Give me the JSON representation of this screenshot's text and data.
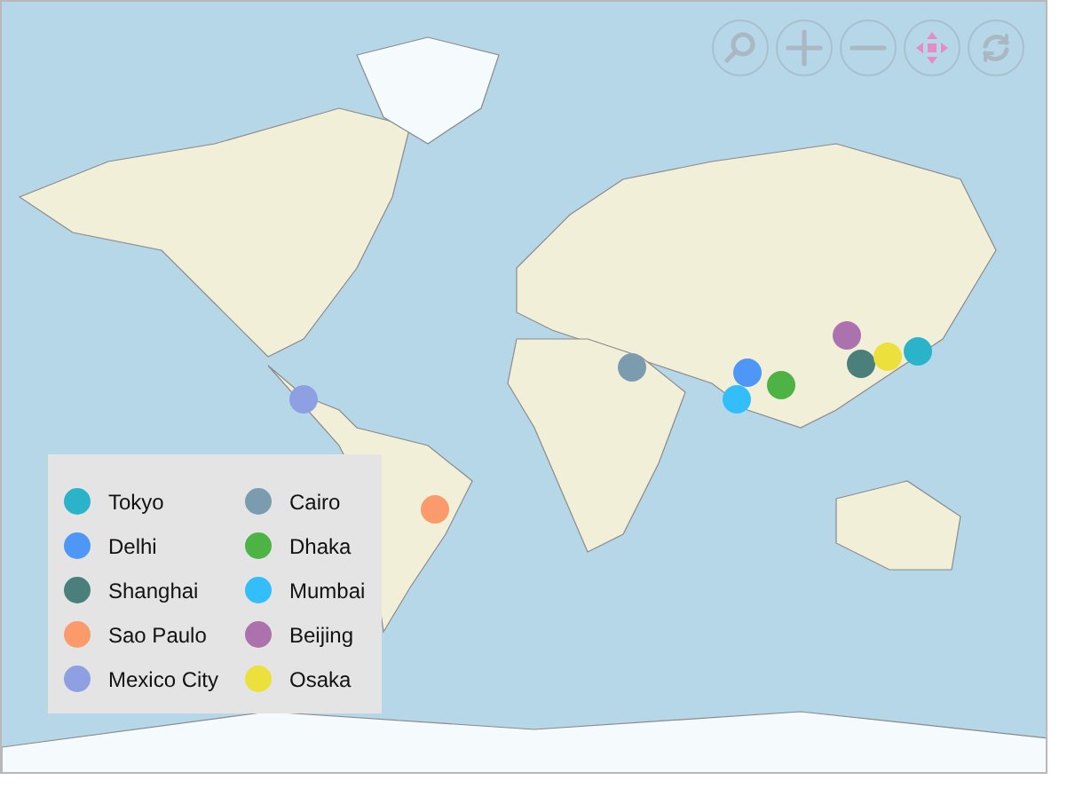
{
  "toolbar": [
    {
      "kind": "zoom"
    },
    {
      "kind": "zoom-in"
    },
    {
      "kind": "zoom-out"
    },
    {
      "kind": "pan",
      "selected": true
    },
    {
      "kind": "reset"
    }
  ],
  "cities": [
    {
      "name": "Tokyo",
      "color": "#2bb3c9"
    },
    {
      "name": "Delhi",
      "color": "#4e97f7"
    },
    {
      "name": "Shanghai",
      "color": "#4a7f7c"
    },
    {
      "name": "Sao Paulo",
      "color": "#fb9a6a"
    },
    {
      "name": "Mexico City",
      "color": "#8fa0e2"
    },
    {
      "name": "Cairo",
      "color": "#7b9caf"
    },
    {
      "name": "Dhaka",
      "color": "#4db345"
    },
    {
      "name": "Mumbai",
      "color": "#33bdfb"
    },
    {
      "name": "Beijing",
      "color": "#ac72ad"
    },
    {
      "name": "Osaka",
      "color": "#ece03c"
    }
  ]
}
